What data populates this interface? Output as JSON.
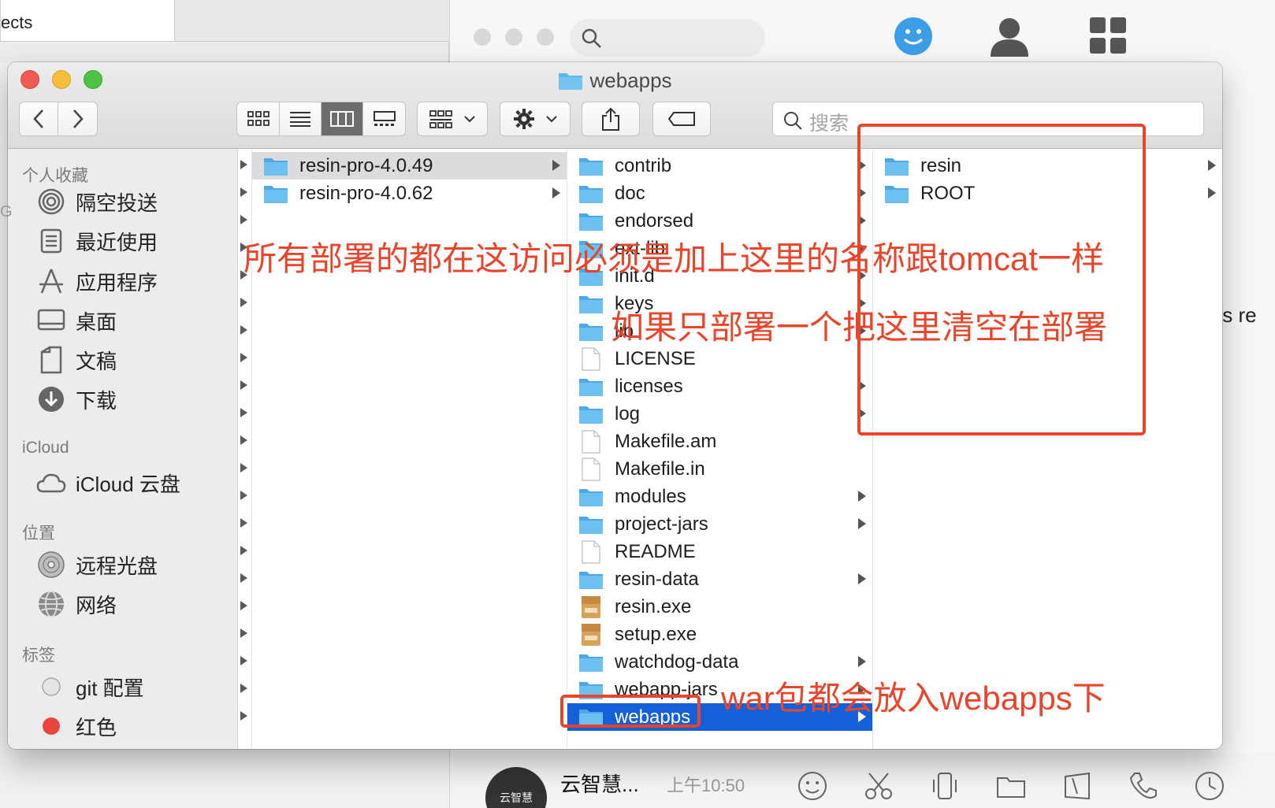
{
  "background": {
    "left_tab_text": "ects",
    "partial_text": "als   re",
    "chat_name": "云智慧...",
    "chat_time": "上午10:50",
    "avatar_text": "云智慧",
    "partial_left": "G"
  },
  "window": {
    "title": "webapps"
  },
  "toolbar": {
    "search_placeholder": "搜索"
  },
  "sidebar": {
    "favorites_header": "个人收藏",
    "favorites": [
      {
        "label": "隔空投送",
        "icon": "airdrop-icon"
      },
      {
        "label": "最近使用",
        "icon": "recents-icon"
      },
      {
        "label": "应用程序",
        "icon": "applications-icon"
      },
      {
        "label": "桌面",
        "icon": "desktop-icon"
      },
      {
        "label": "文稿",
        "icon": "documents-icon"
      },
      {
        "label": "下载",
        "icon": "downloads-icon"
      }
    ],
    "icloud_header": "iCloud",
    "icloud": [
      {
        "label": "iCloud 云盘",
        "icon": "cloud-icon"
      }
    ],
    "locations_header": "位置",
    "locations": [
      {
        "label": "远程光盘",
        "icon": "disc-icon"
      },
      {
        "label": "网络",
        "icon": "network-icon"
      }
    ],
    "tags_header": "标签",
    "tags": [
      {
        "label": "git 配置",
        "color": "#d9d9d9"
      },
      {
        "label": "红色",
        "color": "#e8453c"
      }
    ]
  },
  "columns": {
    "col1": [
      {
        "name": "resin-pro-4.0.49",
        "type": "folder",
        "selected": true
      },
      {
        "name": "resin-pro-4.0.62",
        "type": "folder"
      }
    ],
    "col2": [
      {
        "name": "contrib",
        "type": "folder"
      },
      {
        "name": "doc",
        "type": "folder"
      },
      {
        "name": "endorsed",
        "type": "folder"
      },
      {
        "name": "ext-lib",
        "type": "folder"
      },
      {
        "name": "init.d",
        "type": "folder"
      },
      {
        "name": "keys",
        "type": "folder"
      },
      {
        "name": "lib",
        "type": "folder"
      },
      {
        "name": "LICENSE",
        "type": "file"
      },
      {
        "name": "licenses",
        "type": "folder"
      },
      {
        "name": "log",
        "type": "folder"
      },
      {
        "name": "Makefile.am",
        "type": "file"
      },
      {
        "name": "Makefile.in",
        "type": "file"
      },
      {
        "name": "modules",
        "type": "folder"
      },
      {
        "name": "project-jars",
        "type": "folder"
      },
      {
        "name": "README",
        "type": "file"
      },
      {
        "name": "resin-data",
        "type": "folder"
      },
      {
        "name": "resin.exe",
        "type": "exe"
      },
      {
        "name": "setup.exe",
        "type": "exe"
      },
      {
        "name": "watchdog-data",
        "type": "folder"
      },
      {
        "name": "webapp-jars",
        "type": "folder"
      },
      {
        "name": "webapps",
        "type": "folder",
        "selected": true
      }
    ],
    "col3": [
      {
        "name": "resin",
        "type": "folder"
      },
      {
        "name": "ROOT",
        "type": "folder"
      }
    ]
  },
  "annotations": {
    "note1": "所有部署的都在这访问必须是加上这里的名称跟tomcat一样",
    "note2": "如果只部署一个把这里清空在部署",
    "note3": "war包都会放入webapps下",
    "color": "#e8452b"
  },
  "colors": {
    "folder": "#5eb6ef",
    "selection": "#1460d9"
  }
}
